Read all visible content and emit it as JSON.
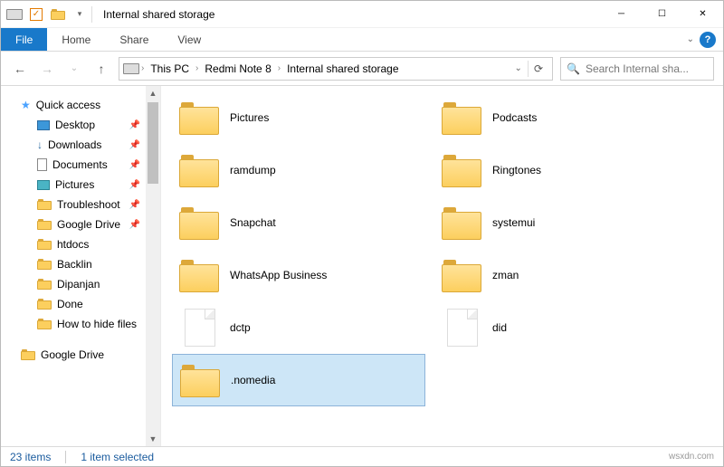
{
  "window_title": "Internal shared storage",
  "ribbon": {
    "file": "File",
    "tabs": [
      "Home",
      "Share",
      "View"
    ]
  },
  "breadcrumbs": [
    "This PC",
    "Redmi Note 8",
    "Internal shared storage"
  ],
  "search_placeholder": "Search Internal sha...",
  "sidebar": {
    "quick_access": "Quick access",
    "items": [
      {
        "label": "Desktop",
        "pin": true,
        "icon": "desktop"
      },
      {
        "label": "Downloads",
        "pin": true,
        "icon": "download"
      },
      {
        "label": "Documents",
        "pin": true,
        "icon": "document"
      },
      {
        "label": "Pictures",
        "pin": true,
        "icon": "picture"
      },
      {
        "label": "Troubleshoot",
        "pin": true,
        "icon": "folder"
      },
      {
        "label": "Google Drive",
        "pin": true,
        "icon": "folder"
      },
      {
        "label": "htdocs",
        "pin": false,
        "icon": "folder"
      },
      {
        "label": "Backlin",
        "pin": false,
        "icon": "folder"
      },
      {
        "label": "Dipanjan",
        "pin": false,
        "icon": "folder"
      },
      {
        "label": "Done",
        "pin": false,
        "icon": "folder"
      },
      {
        "label": "How to hide files",
        "pin": false,
        "icon": "folder"
      }
    ],
    "google_drive_root": "Google Drive"
  },
  "items": [
    {
      "name": "Pictures",
      "type": "folder"
    },
    {
      "name": "Podcasts",
      "type": "folder"
    },
    {
      "name": "ramdump",
      "type": "folder"
    },
    {
      "name": "Ringtones",
      "type": "folder"
    },
    {
      "name": "Snapchat",
      "type": "folder"
    },
    {
      "name": "systemui",
      "type": "folder"
    },
    {
      "name": "WhatsApp Business",
      "type": "folder"
    },
    {
      "name": "zman",
      "type": "folder"
    },
    {
      "name": "dctp",
      "type": "file"
    },
    {
      "name": "did",
      "type": "file"
    },
    {
      "name": ".nomedia",
      "type": "folder",
      "selected": true
    }
  ],
  "status": {
    "count": "23 items",
    "selected": "1 item selected"
  },
  "brand": "wsxdn.com"
}
